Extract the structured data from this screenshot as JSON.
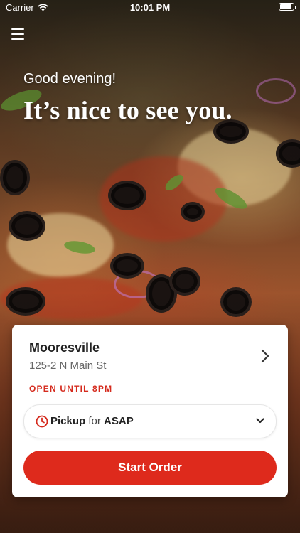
{
  "status_bar": {
    "carrier": "Carrier",
    "time": "10:01 PM",
    "battery_level": 0.9
  },
  "header": {
    "menu_icon": "hamburger-menu-icon"
  },
  "hero": {
    "greeting": "Good evening!",
    "headline": "It’s nice to see you."
  },
  "store": {
    "name": "Mooresville",
    "address": "125-2 N Main St",
    "hours": "OPEN UNTIL 8PM",
    "chevron_icon": "chevron-right-icon"
  },
  "order": {
    "method": "Pickup",
    "connector": "for",
    "time": "ASAP",
    "clock_icon": "clock-icon",
    "dropdown_icon": "chevron-down-icon"
  },
  "actions": {
    "start_label": "Start Order"
  },
  "colors": {
    "accent": "#de2a1c",
    "hours_text": "#d52b1e"
  }
}
